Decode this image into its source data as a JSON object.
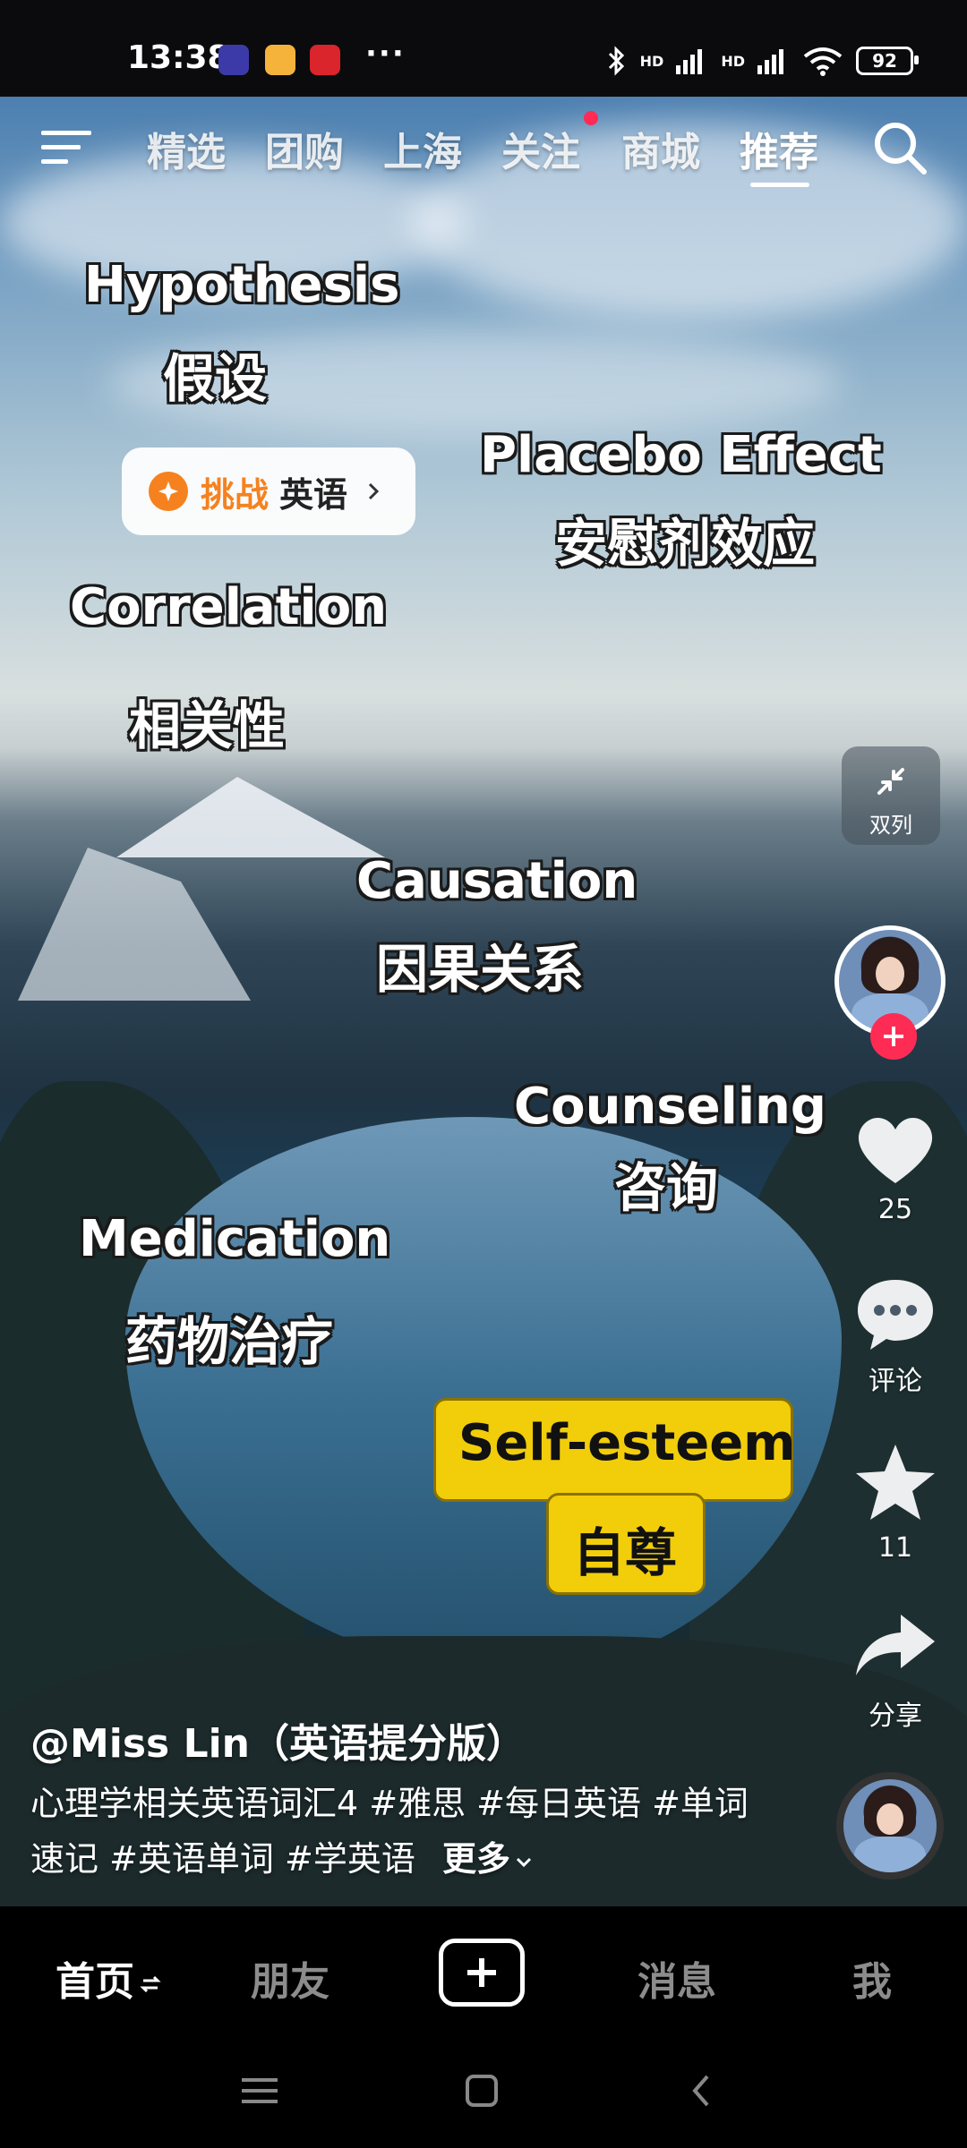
{
  "status_bar": {
    "time": "13:38",
    "battery": "92",
    "signal_labels": [
      "HD",
      "HD"
    ]
  },
  "top_nav": {
    "tabs": [
      {
        "label": "精选",
        "active": false
      },
      {
        "label": "团购",
        "active": false
      },
      {
        "label": "上海",
        "active": false
      },
      {
        "label": "关注",
        "active": false,
        "has_dot": true
      },
      {
        "label": "商城",
        "active": false
      },
      {
        "label": "推荐",
        "active": true
      }
    ],
    "icons": [
      "menu-icon",
      "search-icon"
    ]
  },
  "video": {
    "words": [
      {
        "en": "Hypothesis",
        "zh": "假设"
      },
      {
        "en": "Placebo Effect",
        "zh": "安慰剂效应"
      },
      {
        "en": "Correlation",
        "zh": "相关性"
      },
      {
        "en": "Causation",
        "zh": "因果关系"
      },
      {
        "en": "Counseling",
        "zh": "咨询"
      },
      {
        "en": "Medication",
        "zh": "药物治疗"
      },
      {
        "en": "Self-esteem",
        "zh": "自尊"
      }
    ],
    "challenge": {
      "label": "挑战",
      "text": "英语"
    },
    "dual_column_label": "双列"
  },
  "side_actions": {
    "likes": "25",
    "comment_label": "评论",
    "favorites": "11",
    "share_label": "分享"
  },
  "caption": {
    "author": "@Miss Lin（英语提分版）",
    "line1": "心理学相关英语词汇4 #雅思 #每日英语 #单词",
    "line2": "速记 #英语单词 #学英语",
    "more": "更多"
  },
  "bottom_nav": {
    "home": "首页",
    "friends": "朋友",
    "messages": "消息",
    "me": "我"
  },
  "colors": {
    "accent_red": "#fe2c55",
    "challenge_orange": "#f5821f",
    "highlight_yellow": "#f2cd0a"
  }
}
